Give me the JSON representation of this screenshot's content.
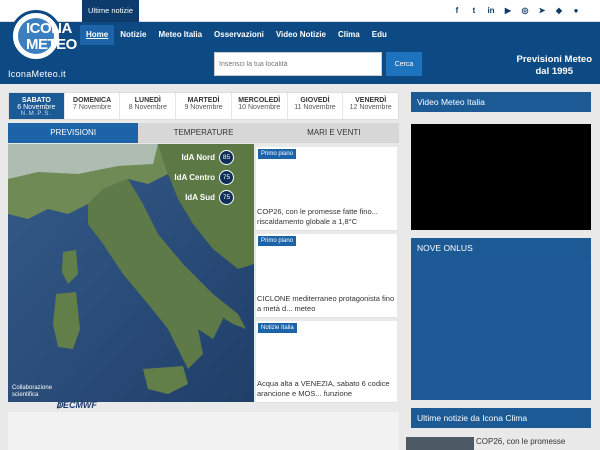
{
  "topbar": {
    "latest_label": "Ultime notizie",
    "social_icons": [
      "facebook-icon",
      "twitter-icon",
      "linkedin-icon",
      "youtube-icon",
      "instagram-icon",
      "telegram-icon",
      "android-icon",
      "apple-icon"
    ]
  },
  "logo": {
    "line1": "ICONA",
    "line2": "METEO",
    "site_url": "IconaMeteo.it"
  },
  "nav": {
    "items": [
      {
        "label": "Home"
      },
      {
        "label": "Notizie"
      },
      {
        "label": "Meteo Italia"
      },
      {
        "label": "Osservazioni"
      },
      {
        "label": "Video Notizie"
      },
      {
        "label": "Clima"
      },
      {
        "label": "Edu"
      }
    ]
  },
  "search": {
    "placeholder": "Inserisci la tua località",
    "button_label": "Cerca"
  },
  "slogan": {
    "line1": "Previsioni Meteo",
    "line2": "dal 1995"
  },
  "days": [
    {
      "day": "SABATO",
      "date": "6 Novembre",
      "extra": "N.M.P.S."
    },
    {
      "day": "DOMENICA",
      "date": "7 Novembre"
    },
    {
      "day": "LUNEDÌ",
      "date": "8 Novembre"
    },
    {
      "day": "MARTEDÌ",
      "date": "9 Novembre"
    },
    {
      "day": "MERCOLEDÌ",
      "date": "10 Novembre"
    },
    {
      "day": "GIOVEDÌ",
      "date": "11 Novembre"
    },
    {
      "day": "VENERDÌ",
      "date": "12 Novembre"
    }
  ],
  "forecast_tabs": [
    "PREVISIONI",
    "TEMPERATURE",
    "MARI E VENTI"
  ],
  "map": {
    "ida": [
      {
        "label": "IdA Nord",
        "value": "85"
      },
      {
        "label": "IdA Centro",
        "value": "75"
      },
      {
        "label": "IdA Sud",
        "value": "75"
      }
    ],
    "collab_line1": "Collaborazione",
    "collab_line2": "scientifica",
    "ecmwf": "ECMWF"
  },
  "news": [
    {
      "tag": "Primo piano",
      "title": "COP26, con le promesse fatte fino... riscaldamento globale a 1,8°C"
    },
    {
      "tag": "Primo piano",
      "title": "CICLONE mediterraneo protagonista fino a metà d... meteo"
    },
    {
      "tag": "Notizie Italia",
      "title": "Acqua alta a VENEZIA, sabato 6 codice arancione e MOS... funzione"
    }
  ],
  "right": {
    "video_header": "Video Meteo Italia",
    "onlus_header": "NOVE ONLUS",
    "clima_header": "Ultime notizie da Icona Clima",
    "clima_item": "COP26, con le promesse"
  },
  "colors": {
    "brand_dark": "#0d4a84",
    "brand_accent": "#1c63a8"
  }
}
